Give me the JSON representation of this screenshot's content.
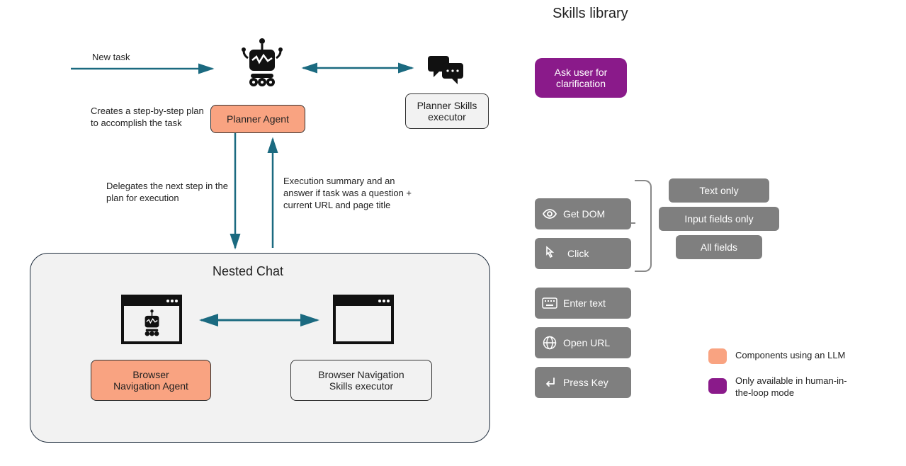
{
  "title": "Skills library",
  "flow": {
    "new_task": "New task",
    "planner_agent": "Planner Agent",
    "planner_skills_executor": "Planner Skills\nexecutor",
    "creates_plan": "Creates a step-by-step\nplan to accomplish the\ntask",
    "delegates": "Delegates the next step in\nthe plan for execution",
    "exec_summary": "Execution summary and an\nanswer if task was a question\n+ current URL and page title",
    "nested_chat_label": "Nested Chat",
    "browser_nav_agent": "Browser\nNavigation Agent",
    "browser_nav_skills": "Browser Navigation\nSkills executor"
  },
  "skills": {
    "ask_user": "Ask user for\nclarification",
    "get_dom": "Get DOM",
    "dom_text_only": "Text only",
    "dom_input_fields": "Input fields only",
    "dom_all_fields": "All fields",
    "click": "Click",
    "enter_text": "Enter text",
    "open_url": "Open URL",
    "press_key": "Press Key"
  },
  "legend": {
    "llm": "Components using an LLM",
    "hitl": "Only available in human-in-\nthe-loop mode"
  },
  "colors": {
    "arrow": "#1b6a80",
    "orange": "#f9a381",
    "purple": "#8a1a8a",
    "grey": "#7f7f7f"
  }
}
